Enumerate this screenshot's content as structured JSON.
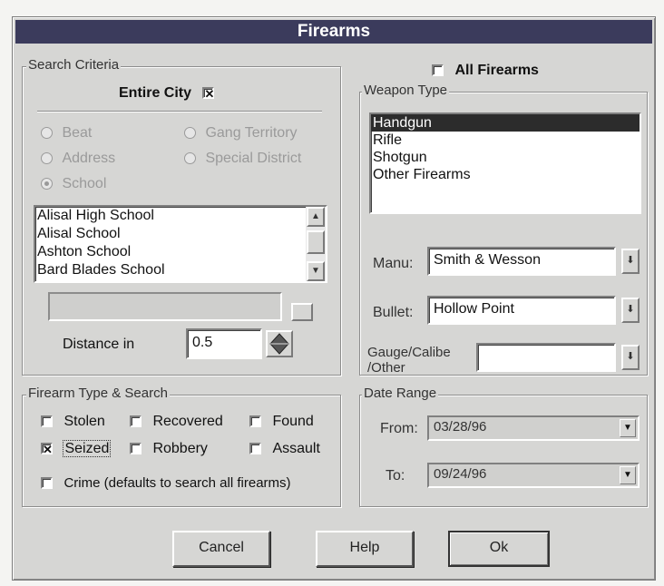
{
  "window": {
    "title": "Firearms"
  },
  "search_criteria": {
    "group_label": "Search Criteria",
    "entire_city_label": "Entire City",
    "entire_city_checked": true,
    "radio_beat": "Beat",
    "radio_gang": "Gang Territory",
    "radio_address": "Address",
    "radio_special": "Special District",
    "radio_school": "School",
    "list_items": [
      "Alisal High School",
      "Alisal School",
      "Ashton School",
      "Bard Blades School"
    ],
    "distance_label": "Distance in",
    "distance_value": "0.5"
  },
  "all_firearms": {
    "label": "All Firearms",
    "checked": false
  },
  "weapon_type": {
    "group_label": "Weapon Type",
    "items": [
      "Handgun",
      "Rifle",
      "Shotgun",
      "Other Firearms"
    ],
    "selected_index": 0,
    "manu_label": "Manu:",
    "manu_value": "Smith & Wesson",
    "bullet_label": "Bullet:",
    "bullet_value": "Hollow Point",
    "gauge_label_line1": "Gauge/Calibe",
    "gauge_label_line2": "/Other",
    "gauge_value": ""
  },
  "firearm_type": {
    "group_label": "Firearm Type & Search",
    "stolen": "Stolen",
    "recovered": "Recovered",
    "found": "Found",
    "seized": "Seized",
    "seized_checked": true,
    "robbery": "Robbery",
    "assault": "Assault",
    "crime": "Crime (defaults to search all firearms)"
  },
  "date_range": {
    "group_label": "Date Range",
    "from_label": "From:",
    "from_value": "03/28/96",
    "to_label": "To:",
    "to_value": "09/24/96"
  },
  "buttons": {
    "cancel": "Cancel",
    "help": "Help",
    "ok": "Ok"
  },
  "icons": {
    "checkbox_mark": "x-mark-icon",
    "dropdown": "down-arrow-icon",
    "scroll_up": "up-arrow-icon",
    "scroll_down": "down-arrow-icon",
    "spinner": "diamond-spinner-icon",
    "browse": "browse-button-icon"
  },
  "colors": {
    "title_bg": "#3b3b5c",
    "selection_bg": "#2c2c2c",
    "dialog_bg": "#d6d6d4"
  }
}
